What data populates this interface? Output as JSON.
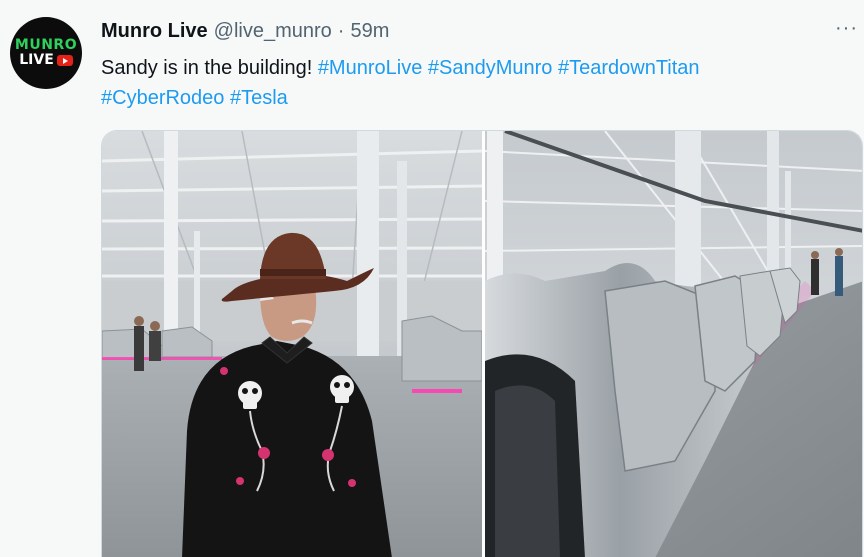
{
  "tweet": {
    "avatar_line1": "MUNRO",
    "avatar_line2": "LIVE",
    "display_name": "Munro Live",
    "handle": "@live_munro",
    "separator": "·",
    "time": "59m",
    "more": "···",
    "text_plain": "Sandy is in the building! ",
    "hashtags": [
      "#MunroLive",
      "#SandyMunro",
      "#TeardownTitan",
      "#CyberRodeo",
      "#Tesla"
    ]
  },
  "colors": {
    "link": "#1d9bf0",
    "text": "#0f1419",
    "secondary": "#536471",
    "brand_green": "#2fd05d",
    "neon_pink": "#ff3fb3"
  },
  "media": {
    "images": [
      {
        "icon": "man-in-cowboy-hat-photo"
      },
      {
        "icon": "car-body-assembly-line-photo"
      }
    ]
  }
}
